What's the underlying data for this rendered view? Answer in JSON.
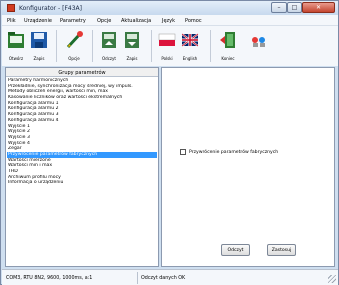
{
  "window": {
    "title": "Konfigurator - [F43A]",
    "controls": {
      "minimize": "–",
      "maximize": "□",
      "close": "✕"
    }
  },
  "menu": [
    "Plik",
    "Urządzenie",
    "Parametry",
    "Opcje",
    "Aktualizacja",
    "Język",
    "Pomoc"
  ],
  "toolbar": [
    {
      "label": "Otwórz",
      "icon": "open-folder-icon"
    },
    {
      "label": "Zapis",
      "icon": "save-disk-icon"
    },
    {
      "label": "Opcje",
      "icon": "options-wand-icon"
    },
    {
      "label": "Odczyt",
      "icon": "read-device-icon"
    },
    {
      "label": "Zapis",
      "icon": "write-device-icon"
    },
    {
      "label": "Polski",
      "icon": "polish-flag-icon"
    },
    {
      "label": "English",
      "icon": "uk-flag-icon"
    },
    {
      "label": "Koniec",
      "icon": "exit-door-icon"
    },
    {
      "label": "",
      "icon": "about-people-icon"
    }
  ],
  "groups": {
    "header": "Grupy parametrów",
    "items": [
      "Parametry harmonicznych",
      "Przekładnie, synchronizacja mocy średniej, wy impuls.",
      "Metody obliczeń energii, wartości min, max",
      "Kasowanie liczników oraz wartości ekstremalnych",
      "Konfiguracja alarmu 1",
      "Konfiguracja alarmu 2",
      "Konfiguracja alarmu 3",
      "Konfiguracja alarmu 4",
      "Wyjście 1",
      "Wyjście 2",
      "Wyjście 3",
      "Wyjście 4",
      "Zegar",
      "Przywrócenie parametrów fabrycznych",
      "Wartości mierzone",
      "Wartości min i max",
      "THD",
      "Archiwum profilu mocy",
      "Informacja o urządzeniu"
    ],
    "selected_index": 13
  },
  "right": {
    "checkbox_label": "Przywrócenie parametrów fabrycznych",
    "checked": false,
    "read_button": "Odczyt",
    "write_button": "Zastosuj"
  },
  "status": {
    "connection": "COM3, RTU 8N2, 9600, 1000ms, a:1",
    "message": "Odczyt danych OK"
  }
}
